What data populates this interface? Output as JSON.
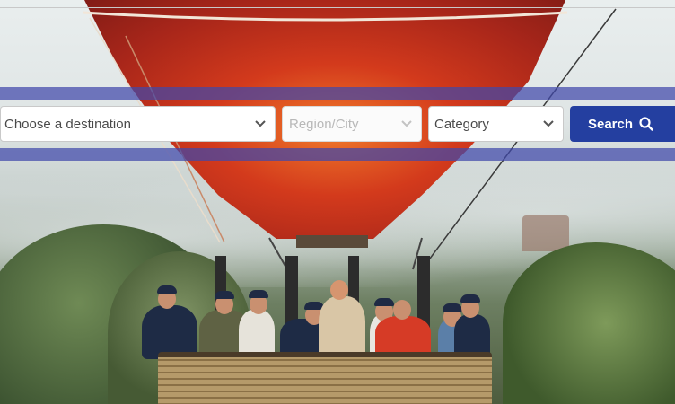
{
  "search_bar": {
    "destination": {
      "placeholder": "Choose a destination",
      "icon": "chevron-down-icon"
    },
    "region": {
      "placeholder": "Region/City",
      "disabled": true,
      "icon": "chevron-down-icon"
    },
    "category": {
      "placeholder": "Category",
      "icon": "chevron-down-icon"
    },
    "search_button": {
      "label": "Search",
      "icon": "search-icon"
    }
  },
  "colors": {
    "band": "#4048aa",
    "button": "#243fa0",
    "balloon": "#d33a1c"
  }
}
